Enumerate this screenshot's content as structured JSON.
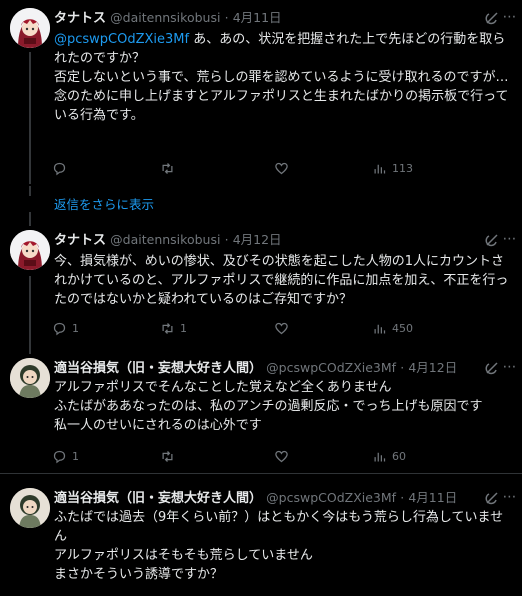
{
  "tweets": [
    {
      "name": "タナトス",
      "handle": "@daitennsikobusi",
      "dot": "·",
      "date": "4月11日",
      "mention": "@pcswpCOdZXie3Mf",
      "lines": [
        "あ、あの、状況を把握された上で先ほどの行動を取られたのですか？",
        "否定しないという事で、荒らしの罪を認めているように受け取れるのですが…",
        "念のために申し上げますとアルファポリスと生まれたばかりの掲示板で行っている行為です。"
      ],
      "replies": "",
      "retweets": "",
      "likes": "",
      "views": "113"
    },
    {
      "name": "タナトス",
      "handle": "@daitennsikobusi",
      "dot": "·",
      "date": "4月12日",
      "lines": [
        "今、損気様が、めいの惨状、及びその状態を起こした人物の1人にカウントされかけているのと、アルファポリスで継続的に作品に加点を加え、不正を行ったのではないかと疑われているのはご存知ですか？"
      ],
      "replies": "1",
      "retweets": "1",
      "likes": "",
      "views": "450"
    },
    {
      "name": "適当谷損気（旧・妄想大好き人間）",
      "handle": "@pcswpCOdZXie3Mf",
      "dot": "·",
      "date": "4月12日",
      "lines": [
        "アルファポリスでそんなことした覚えなど全くありません",
        "ふたばがああなったのは、私のアンチの過剰反応・でっち上げも原因です",
        "私一人のせいにされるのは心外です"
      ],
      "replies": "1",
      "retweets": "",
      "likes": "",
      "views": "60"
    },
    {
      "name": "適当谷損気（旧・妄想大好き人間）",
      "handle": "@pcswpCOdZXie3Mf",
      "dot": "·",
      "date": "4月11日",
      "lines": [
        "ふたばでは過去（9年くらい前？）はともかく今はもう荒らし行為していません",
        "アルファポリスはそもそも荒らしていません",
        "まさかそういう誘導ですか？"
      ]
    }
  ],
  "show_more_replies": "返信をさらに表示",
  "icons": {
    "reply": "reply-icon",
    "retweet": "retweet-icon",
    "like": "heart-icon",
    "views": "views-icon",
    "grok": "grok-icon",
    "more": "more-icon"
  },
  "colors": {
    "background": "#000000",
    "text": "#e7e9ea",
    "muted": "#71767b",
    "link": "#1d9bf0",
    "divider": "#2f3336"
  }
}
